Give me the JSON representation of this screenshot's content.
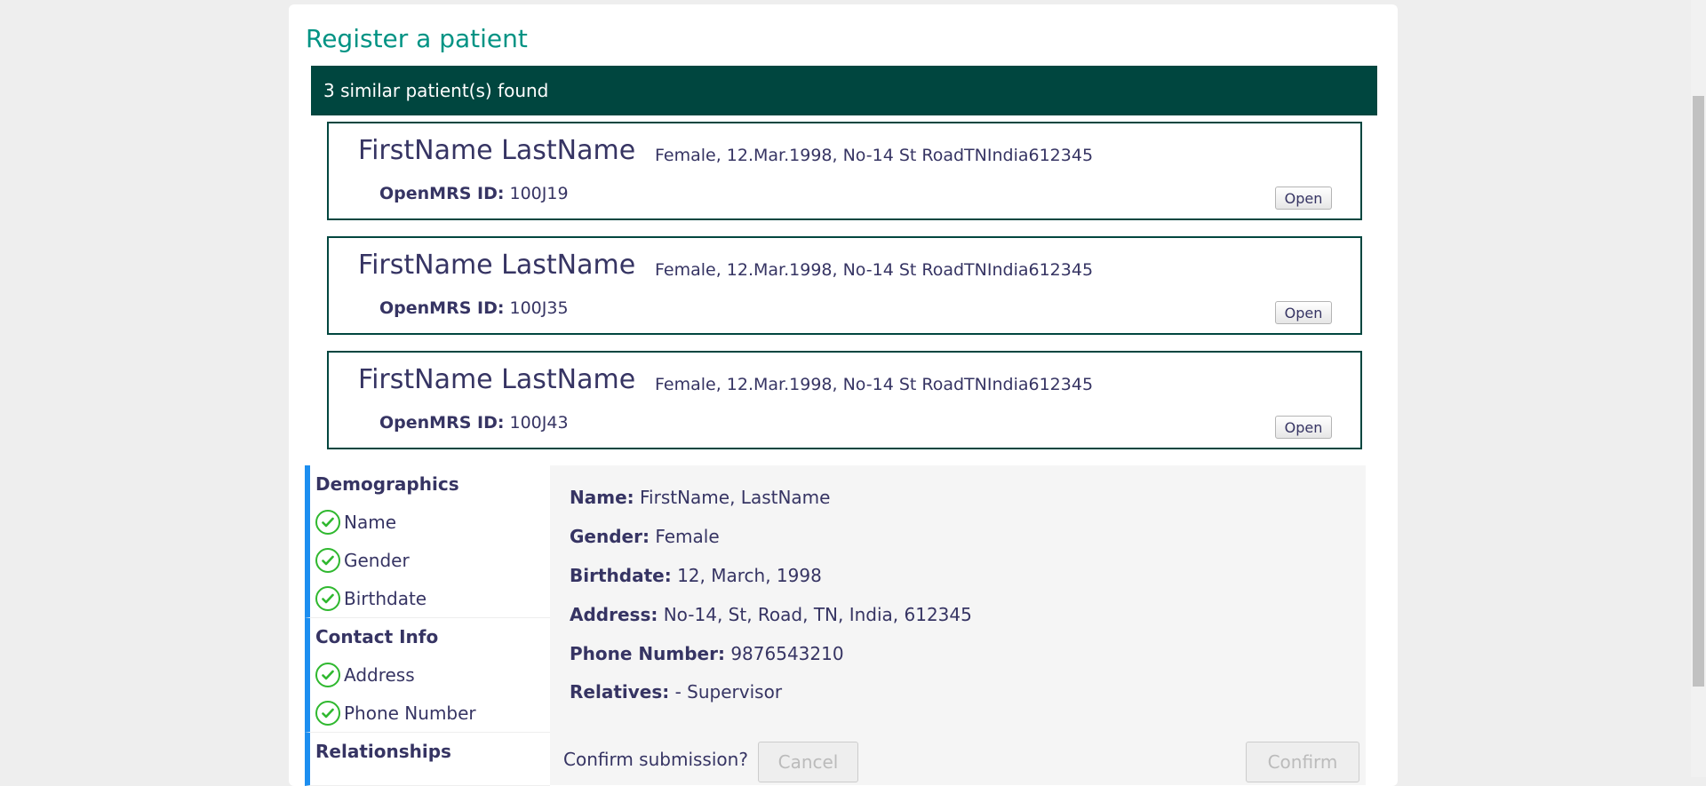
{
  "page": {
    "title": "Register a patient"
  },
  "similar": {
    "banner": "3 similar patient(s) found",
    "id_label": "OpenMRS ID:",
    "open_label": "Open",
    "matches": [
      {
        "name": "FirstName LastName",
        "details": "Female, 12.Mar.1998, No-14 St RoadTNIndia612345",
        "id": "100J19"
      },
      {
        "name": "FirstName LastName",
        "details": "Female, 12.Mar.1998, No-14 St RoadTNIndia612345",
        "id": "100J35"
      },
      {
        "name": "FirstName LastName",
        "details": "Female, 12.Mar.1998, No-14 St RoadTNIndia612345",
        "id": "100J43"
      }
    ]
  },
  "sidebar": {
    "sections": [
      {
        "title": "Demographics",
        "steps": [
          "Name",
          "Gender",
          "Birthdate"
        ]
      },
      {
        "title": "Contact Info",
        "steps": [
          "Address",
          "Phone Number"
        ]
      },
      {
        "title": "Relationships",
        "steps": []
      }
    ]
  },
  "summary": {
    "name_label": "Name:",
    "name_value": "FirstName, LastName",
    "gender_label": "Gender:",
    "gender_value": "Female",
    "birthdate_label": "Birthdate:",
    "birthdate_value": "12, March, 1998",
    "address_label": "Address:",
    "address_value": "No-14, St, Road, TN, India, 612345",
    "phone_label": "Phone Number:",
    "phone_value": "9876543210",
    "relatives_label": "Relatives:",
    "relatives_value": "- Supervisor"
  },
  "confirm": {
    "question": "Confirm submission?",
    "cancel_label": "Cancel",
    "confirm_label": "Confirm"
  },
  "colors": {
    "title": "#009384",
    "banner_bg": "#00463f",
    "accent_bar": "#1c8ef0",
    "check": "#2fb82f",
    "text": "#363463"
  },
  "icons": {
    "step_complete": "check-circle-icon"
  }
}
